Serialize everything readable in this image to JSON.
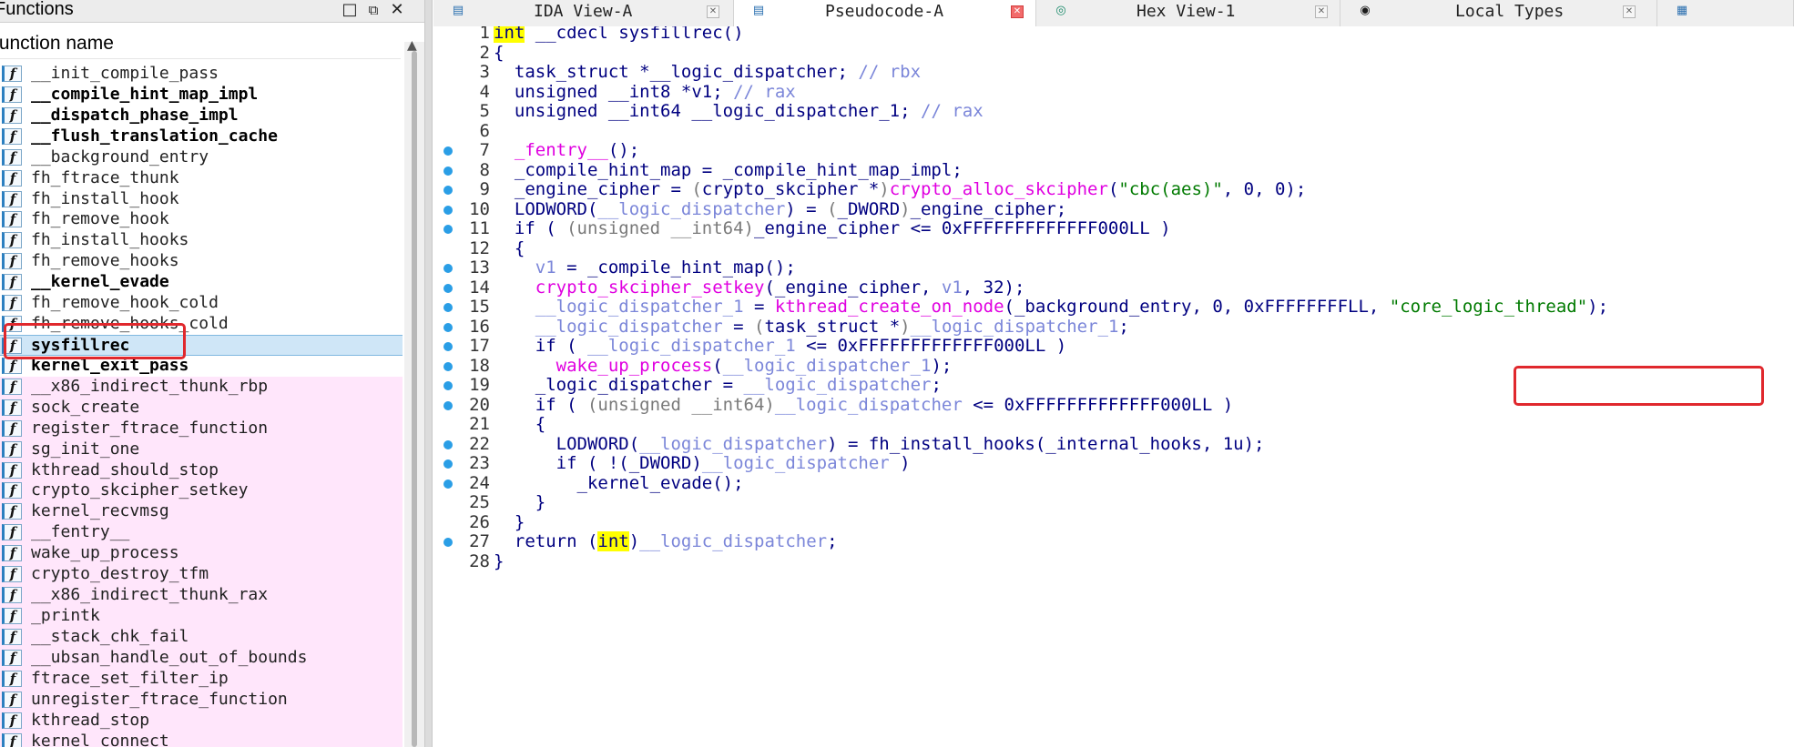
{
  "functions_panel": {
    "title": "Functions",
    "column_header": "Function name",
    "icon_glyph": "f",
    "items": [
      {
        "name": "__init_compile_pass",
        "bold": false,
        "style": "normal"
      },
      {
        "name": "__compile_hint_map_impl",
        "bold": true,
        "style": "normal"
      },
      {
        "name": "__dispatch_phase_impl",
        "bold": true,
        "style": "normal"
      },
      {
        "name": "__flush_translation_cache",
        "bold": true,
        "style": "normal"
      },
      {
        "name": "__background_entry",
        "bold": false,
        "style": "normal"
      },
      {
        "name": "fh_ftrace_thunk",
        "bold": false,
        "style": "normal"
      },
      {
        "name": "fh_install_hook",
        "bold": false,
        "style": "normal"
      },
      {
        "name": "fh_remove_hook",
        "bold": false,
        "style": "normal"
      },
      {
        "name": "fh_install_hooks",
        "bold": false,
        "style": "normal"
      },
      {
        "name": "fh_remove_hooks",
        "bold": false,
        "style": "normal"
      },
      {
        "name": "__kernel_evade",
        "bold": true,
        "style": "normal"
      },
      {
        "name": "fh_remove_hook_cold",
        "bold": false,
        "style": "normal"
      },
      {
        "name": "fh_remove_hooks_cold",
        "bold": false,
        "style": "normal"
      },
      {
        "name": "sysfillrec",
        "bold": true,
        "style": "selected"
      },
      {
        "name": "kernel_exit_pass",
        "bold": true,
        "style": "normal"
      },
      {
        "name": "__x86_indirect_thunk_rbp",
        "bold": false,
        "style": "pink"
      },
      {
        "name": "sock_create",
        "bold": false,
        "style": "pink"
      },
      {
        "name": "register_ftrace_function",
        "bold": false,
        "style": "pink"
      },
      {
        "name": "sg_init_one",
        "bold": false,
        "style": "pink"
      },
      {
        "name": "kthread_should_stop",
        "bold": false,
        "style": "pink"
      },
      {
        "name": "crypto_skcipher_setkey",
        "bold": false,
        "style": "pink"
      },
      {
        "name": "kernel_recvmsg",
        "bold": false,
        "style": "pink"
      },
      {
        "name": "__fentry__",
        "bold": false,
        "style": "pink"
      },
      {
        "name": "wake_up_process",
        "bold": false,
        "style": "pink"
      },
      {
        "name": "crypto_destroy_tfm",
        "bold": false,
        "style": "pink"
      },
      {
        "name": "__x86_indirect_thunk_rax",
        "bold": false,
        "style": "pink"
      },
      {
        "name": "_printk",
        "bold": false,
        "style": "pink"
      },
      {
        "name": "__stack_chk_fail",
        "bold": false,
        "style": "pink"
      },
      {
        "name": "__ubsan_handle_out_of_bounds",
        "bold": false,
        "style": "pink"
      },
      {
        "name": "ftrace_set_filter_ip",
        "bold": false,
        "style": "pink"
      },
      {
        "name": "unregister_ftrace_function",
        "bold": false,
        "style": "pink"
      },
      {
        "name": "kthread_stop",
        "bold": false,
        "style": "pink"
      },
      {
        "name": "kernel_connect",
        "bold": false,
        "style": "pink"
      }
    ]
  },
  "tabs": [
    {
      "label": "IDA View-A",
      "icon": "ida-view-icon",
      "active": false
    },
    {
      "label": "Pseudocode-A",
      "icon": "pseudocode-icon",
      "active": true
    },
    {
      "label": "Hex View-1",
      "icon": "hex-view-icon",
      "active": false
    },
    {
      "label": "Local Types",
      "icon": "local-types-icon",
      "active": false
    }
  ],
  "code_lines": [
    {
      "num": "1",
      "bp": false,
      "tokens": [
        [
          "kw",
          "int"
        ],
        [
          "t",
          " __cdecl sysfillrec()"
        ]
      ]
    },
    {
      "num": "2",
      "bp": false,
      "tokens": [
        [
          "t",
          "{"
        ]
      ]
    },
    {
      "num": "3",
      "bp": false,
      "tokens": [
        [
          "t",
          "  task_struct *__logic_dispatcher; "
        ],
        [
          "cm",
          "// rbx"
        ]
      ]
    },
    {
      "num": "4",
      "bp": false,
      "tokens": [
        [
          "t",
          "  unsigned __int8 *v1; "
        ],
        [
          "cm",
          "// rax"
        ]
      ]
    },
    {
      "num": "5",
      "bp": false,
      "tokens": [
        [
          "t",
          "  unsigned __int64 __logic_dispatcher_1; "
        ],
        [
          "cm",
          "// rax"
        ]
      ]
    },
    {
      "num": "6",
      "bp": false,
      "tokens": [
        [
          "t",
          ""
        ]
      ]
    },
    {
      "num": "7",
      "bp": true,
      "tokens": [
        [
          "t",
          "  "
        ],
        [
          "fn",
          "_fentry__"
        ],
        [
          "t",
          "();"
        ]
      ]
    },
    {
      "num": "8",
      "bp": true,
      "tokens": [
        [
          "t",
          "  _compile_hint_map = _compile_hint_map_impl;"
        ]
      ]
    },
    {
      "num": "9",
      "bp": true,
      "tokens": [
        [
          "t",
          "  _engine_cipher = "
        ],
        [
          "cast",
          "("
        ],
        [
          "t",
          "crypto_skcipher *"
        ],
        [
          "cast",
          ")"
        ],
        [
          "fn",
          "crypto_alloc_skcipher"
        ],
        [
          "t",
          "("
        ],
        [
          "str",
          "\"cbc(aes)\""
        ],
        [
          "t",
          ", 0, 0);"
        ]
      ]
    },
    {
      "num": "10",
      "bp": true,
      "tokens": [
        [
          "t",
          "  LODWORD("
        ],
        [
          "gv",
          "__logic_dispatcher"
        ],
        [
          "t",
          ") = "
        ],
        [
          "cast",
          "("
        ],
        [
          "t",
          "_DWORD"
        ],
        [
          "cast",
          ")"
        ],
        [
          "t",
          "_engine_cipher;"
        ]
      ]
    },
    {
      "num": "11",
      "bp": true,
      "tokens": [
        [
          "t",
          "  if ( "
        ],
        [
          "cast",
          "(unsigned __int64)"
        ],
        [
          "t",
          "_engine_cipher <= 0xFFFFFFFFFFFFF000LL )"
        ]
      ]
    },
    {
      "num": "12",
      "bp": false,
      "tokens": [
        [
          "t",
          "  {"
        ]
      ]
    },
    {
      "num": "13",
      "bp": true,
      "tokens": [
        [
          "t",
          "    "
        ],
        [
          "gv",
          "v1"
        ],
        [
          "t",
          " = _compile_hint_map();"
        ]
      ]
    },
    {
      "num": "14",
      "bp": true,
      "tokens": [
        [
          "t",
          "    "
        ],
        [
          "fn",
          "crypto_skcipher_setkey"
        ],
        [
          "t",
          "(_engine_cipher, "
        ],
        [
          "gv",
          "v1"
        ],
        [
          "t",
          ", 32);"
        ]
      ]
    },
    {
      "num": "15",
      "bp": true,
      "tokens": [
        [
          "t",
          "    "
        ],
        [
          "gv",
          "__logic_dispatcher_1"
        ],
        [
          "t",
          " = "
        ],
        [
          "fn",
          "kthread_create_on_node"
        ],
        [
          "t",
          "(_background_entry, 0, 0xFFFFFFFFLL, "
        ],
        [
          "str",
          "\"core_logic_thread\""
        ],
        [
          "t",
          ");"
        ]
      ]
    },
    {
      "num": "16",
      "bp": true,
      "tokens": [
        [
          "t",
          "    "
        ],
        [
          "gv",
          "__logic_dispatcher"
        ],
        [
          "t",
          " = "
        ],
        [
          "cast",
          "("
        ],
        [
          "t",
          "task_struct *"
        ],
        [
          "cast",
          ")"
        ],
        [
          "gv",
          "__logic_dispatcher_1"
        ],
        [
          "t",
          ";"
        ]
      ]
    },
    {
      "num": "17",
      "bp": true,
      "tokens": [
        [
          "t",
          "    if ( "
        ],
        [
          "gv",
          "__logic_dispatcher_1"
        ],
        [
          "t",
          " <= 0xFFFFFFFFFFFFF000LL )"
        ]
      ]
    },
    {
      "num": "18",
      "bp": true,
      "tokens": [
        [
          "t",
          "      "
        ],
        [
          "fn",
          "wake_up_process"
        ],
        [
          "t",
          "("
        ],
        [
          "gv",
          "__logic_dispatcher_1"
        ],
        [
          "t",
          ");"
        ]
      ]
    },
    {
      "num": "19",
      "bp": true,
      "tokens": [
        [
          "t",
          "    _logic_dispatcher = "
        ],
        [
          "gv",
          "__logic_dispatcher"
        ],
        [
          "t",
          ";"
        ]
      ]
    },
    {
      "num": "20",
      "bp": true,
      "tokens": [
        [
          "t",
          "    if ( "
        ],
        [
          "cast",
          "(unsigned __int64)"
        ],
        [
          "gv",
          "__logic_dispatcher"
        ],
        [
          "t",
          " <= 0xFFFFFFFFFFFFF000LL )"
        ]
      ]
    },
    {
      "num": "21",
      "bp": false,
      "tokens": [
        [
          "t",
          "    {"
        ]
      ]
    },
    {
      "num": "22",
      "bp": true,
      "tokens": [
        [
          "t",
          "      LODWORD("
        ],
        [
          "gv",
          "__logic_dispatcher"
        ],
        [
          "t",
          ") = fh_install_hooks(_internal_hooks, 1u);"
        ]
      ]
    },
    {
      "num": "23",
      "bp": true,
      "tokens": [
        [
          "t",
          "      if ( !("
        ],
        [
          "t",
          "_DWORD"
        ],
        [
          "t",
          ")"
        ],
        [
          "gv",
          "__logic_dispatcher"
        ],
        [
          "t",
          " )"
        ]
      ]
    },
    {
      "num": "24",
      "bp": true,
      "tokens": [
        [
          "t",
          "        _kernel_evade();"
        ]
      ]
    },
    {
      "num": "25",
      "bp": false,
      "tokens": [
        [
          "t",
          "    }"
        ]
      ]
    },
    {
      "num": "26",
      "bp": false,
      "tokens": [
        [
          "t",
          "  }"
        ]
      ]
    },
    {
      "num": "27",
      "bp": true,
      "tokens": [
        [
          "t",
          "  return ("
        ],
        [
          "kw",
          "int"
        ],
        [
          "t",
          ")"
        ],
        [
          "gv",
          "__logic_dispatcher"
        ],
        [
          "t",
          ";"
        ]
      ]
    },
    {
      "num": "28",
      "bp": false,
      "tokens": [
        [
          "t",
          "}"
        ]
      ]
    }
  ],
  "colors": {
    "keyword_highlight": "#ffff00",
    "function_call": "#e000e0",
    "string_literal": "#007a00",
    "comment": "#7b86d9",
    "annotation_box": "#e0282d",
    "imported_function_bg": "#ffe6fb",
    "selected_row_bg": "#cfe6f7"
  }
}
